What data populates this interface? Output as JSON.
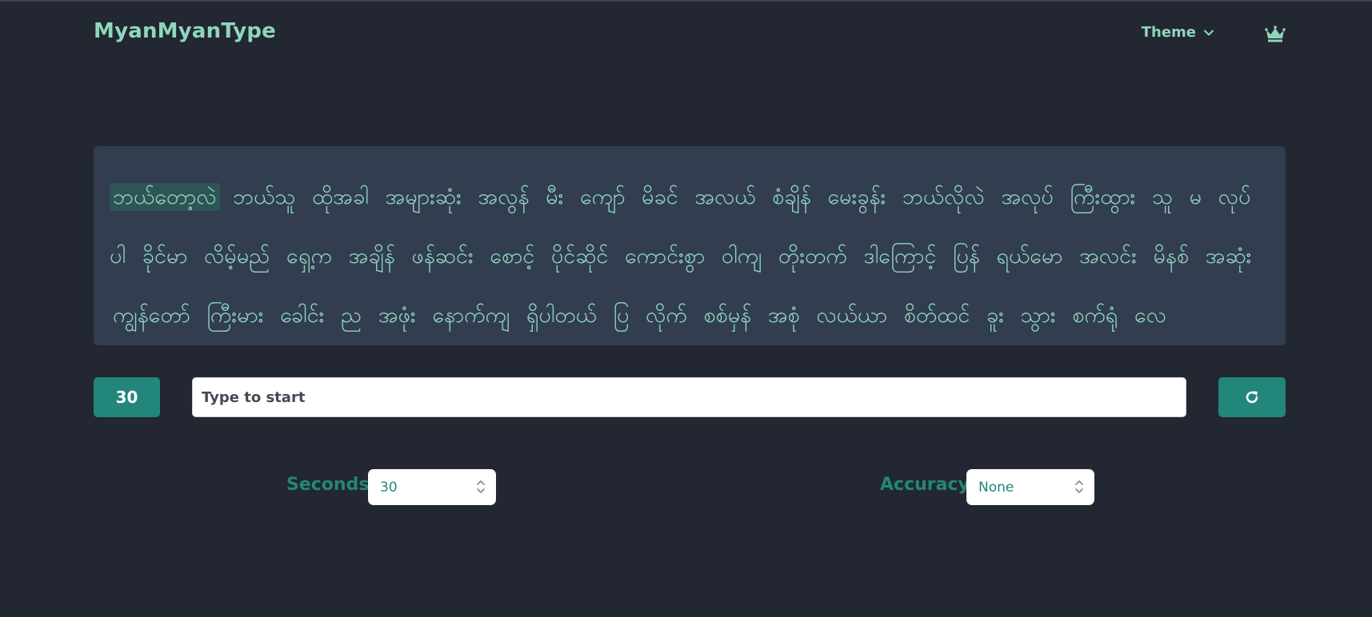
{
  "app": {
    "brand": "MyanMyanType",
    "theme_label": "Theme",
    "icons": {
      "theme_dropdown": "chevron-down-icon",
      "premium": "crown-icon",
      "reset": "redo-icon"
    }
  },
  "passage": {
    "current_word": "ဘယ်တော့လဲ",
    "words": [
      "ဘယ်တော့လဲ",
      "ဘယ်သူ",
      "ထိုအခါ",
      "အများဆုံး",
      "အလွန်",
      "မီး",
      "ကျော်",
      "မိခင်",
      "အလယ်",
      "စံချိန်",
      "မေးခွန်း",
      "ဘယ်လိုလဲ",
      "အလုပ်",
      "ကြီးထွား",
      "သူ",
      "မ",
      "လုပ်ပါ",
      "ခိုင်မာ",
      "လိမ့်မည်",
      "ရှေ့က",
      "အချိန်",
      "ဖန်ဆင်း",
      "စောင့်",
      "ပိုင်ဆိုင်",
      "ကောင်းစွာ",
      "ဝါကျ",
      "တိုးတက်",
      "ဒါကြောင့်",
      "ပြန်",
      "ရယ်မော",
      "အလင်း",
      "မိနစ်",
      "အဆုံး",
      "ကျွန်တော်",
      "ကြီးမား",
      "ခေါင်း",
      "ည",
      "အဖုံး",
      "နောက်ကျ",
      "ရှိပါတယ်",
      "ပြ",
      "လိုက်",
      "စစ်မှန်",
      "အစုံ",
      "လယ်ယာ",
      "စိတ်ထင်",
      "ခူး",
      "သွား",
      "စက်ရုံ",
      "လေ"
    ]
  },
  "controls": {
    "timer_value": "30",
    "input_placeholder": "Type to start",
    "input_value": ""
  },
  "settings": {
    "seconds_label": "Seconds",
    "seconds_value": "30",
    "accuracy_label": "Accuracy",
    "accuracy_value": "None"
  },
  "colors": {
    "background": "#222731",
    "panel": "#323d50",
    "accent": "#23867a",
    "text": "#8fd6bd",
    "highlight": "#2d5556"
  }
}
